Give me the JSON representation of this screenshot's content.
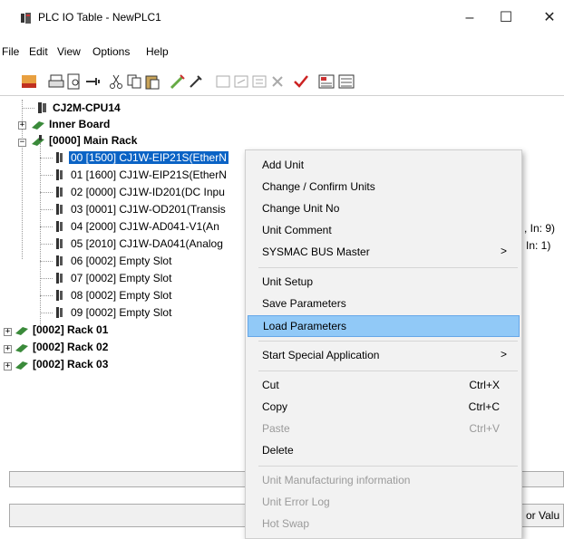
{
  "window": {
    "title": "PLC IO Table - NewPLC1",
    "minimize": "–",
    "maximize": "☐",
    "close": "✕"
  },
  "menu": [
    "File",
    "Edit",
    "View",
    "Options",
    "Help"
  ],
  "tree": {
    "cpu": "CJ2M-CPU14",
    "inner_board": "Inner Board",
    "main_rack": "[0000] Main Rack",
    "slots": [
      "00 [1500] CJ1W-EIP21S(EtherN",
      "01 [1600] CJ1W-EIP21S(EtherN",
      "02 [0000] CJ1W-ID201(DC Inpu",
      "03 [0001] CJ1W-OD201(Transis",
      "04 [2000] CJ1W-AD041-V1(An",
      "05 [2010] CJ1W-DA041(Analog",
      "06 [0002] Empty Slot",
      "07 [0002] Empty Slot",
      "08 [0002] Empty Slot",
      "09 [0002] Empty Slot"
    ],
    "racks": [
      "[0002] Rack 01",
      "[0002] Rack 02",
      "[0002] Rack 03"
    ]
  },
  "right_fragments": {
    "slot04_tail": ", In: 9)",
    "slot05_tail": "In: 1)",
    "status_tail": "or Valu"
  },
  "context_menu": {
    "items": [
      {
        "label": "Add Unit"
      },
      {
        "label": "Change / Confirm Units"
      },
      {
        "label": "Change Unit No"
      },
      {
        "label": "Unit Comment"
      },
      {
        "label": "SYSMAC BUS Master",
        "arrow": ">"
      },
      {
        "label": "Unit Setup"
      },
      {
        "label": "Save Parameters"
      },
      {
        "label": "Load Parameters",
        "highlighted": true
      },
      {
        "label": "Start Special Application",
        "arrow": ">"
      },
      {
        "label": "Cut",
        "shortcut": "Ctrl+X"
      },
      {
        "label": "Copy",
        "shortcut": "Ctrl+C"
      },
      {
        "label": "Paste",
        "shortcut": "Ctrl+V",
        "disabled": true
      },
      {
        "label": "Delete"
      },
      {
        "label": "Unit Manufacturing information",
        "disabled": true
      },
      {
        "label": "Unit Error Log",
        "disabled": true
      },
      {
        "label": "Hot Swap",
        "disabled": true
      }
    ]
  },
  "colors": {
    "selection": "#0b63c5",
    "menu_highlight": "#91c9f7",
    "menu_bg": "#f2f2f2"
  }
}
